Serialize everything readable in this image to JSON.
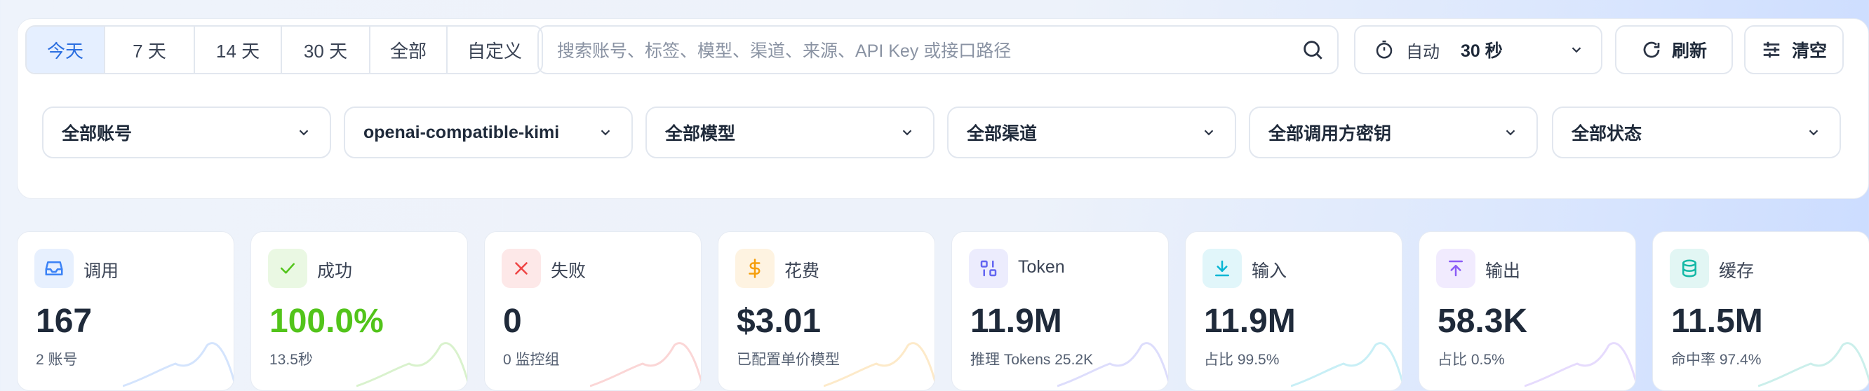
{
  "range_tabs": [
    "今天",
    "7 天",
    "14 天",
    "30 天",
    "全部",
    "自定义"
  ],
  "search": {
    "placeholder": "搜索账号、标签、模型、渠道、来源、API Key 或接口路径"
  },
  "auto_refresh": {
    "label": "自动",
    "interval": "30 秒"
  },
  "refresh_label": "刷新",
  "clear_label": "清空",
  "filters": [
    "全部账号",
    "openai-compatible-kimi",
    "全部模型",
    "全部渠道",
    "全部调用方密钥",
    "全部状态"
  ],
  "cards": [
    {
      "title": "调用",
      "value": "167",
      "sub": "2 账号",
      "icon": "inbox-icon",
      "color": "#3b82f6"
    },
    {
      "title": "成功",
      "value": "100.0%",
      "sub": "13.5秒",
      "icon": "check-icon",
      "color": "#52c41a"
    },
    {
      "title": "失败",
      "value": "0",
      "sub": "0 监控组",
      "icon": "close-icon",
      "color": "#ef4444"
    },
    {
      "title": "花费",
      "value": "$3.01",
      "sub": "已配置单价模型",
      "icon": "dollar-icon",
      "color": "#f59e0b"
    },
    {
      "title": "Token",
      "value": "11.9M",
      "sub": "推理 Tokens 25.2K",
      "icon": "token-icon",
      "color": "#6366f1"
    },
    {
      "title": "输入",
      "value": "11.9M",
      "sub": "占比 99.5%",
      "icon": "download-icon",
      "color": "#06b6d4"
    },
    {
      "title": "输出",
      "value": "58.3K",
      "sub": "占比 0.5%",
      "icon": "upload-icon",
      "color": "#8b5cf6"
    },
    {
      "title": "缓存",
      "value": "11.5M",
      "sub": "命中率 97.4%",
      "icon": "database-icon",
      "color": "#14b8a6"
    }
  ]
}
